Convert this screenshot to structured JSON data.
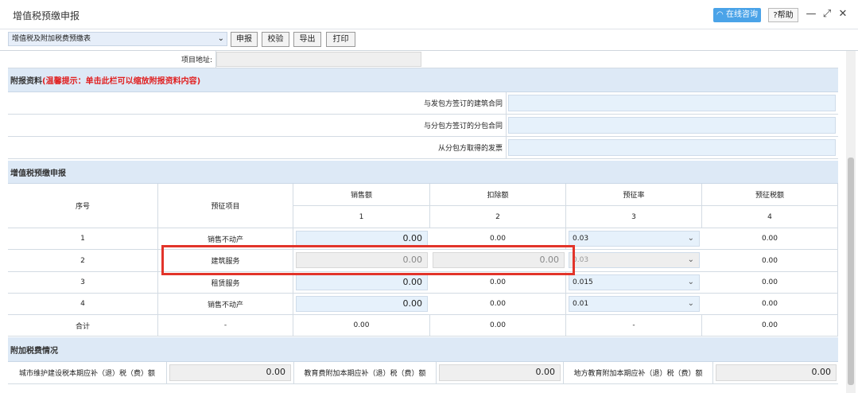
{
  "window": {
    "title": "增值税预缴申报",
    "consult_label": "在线咨询",
    "help_label": "?帮助"
  },
  "toolbar": {
    "report_select": "增值税及附加税费预缴表",
    "declare": "申报",
    "verify": "校验",
    "export": "导出",
    "print": "打印"
  },
  "project_address_label": "项目地址:",
  "attachments": {
    "title": "附报资料",
    "hint": "(温馨提示：单击此栏可以缩放附报资料内容)",
    "items": [
      "与发包方签订的建筑合同",
      "与分包方签订的分包合同",
      "从分包方取得的发票"
    ]
  },
  "vat": {
    "title": "增值税预缴申报",
    "headers": {
      "seq": "序号",
      "item": "预征项目",
      "sales": "销售额",
      "deduct": "扣除额",
      "rate": "预征率",
      "tax": "预征税额"
    },
    "col_nums": [
      "1",
      "2",
      "3",
      "4"
    ],
    "rows": [
      {
        "seq": "1",
        "item": "销售不动产",
        "sales": "0.00",
        "deduct": "0.00",
        "rate": "0.03",
        "tax": "0.00"
      },
      {
        "seq": "2",
        "item": "建筑服务",
        "sales": "0.00",
        "deduct": "0.00",
        "rate": "0.03",
        "tax": "0.00"
      },
      {
        "seq": "3",
        "item": "租赁服务",
        "sales": "0.00",
        "deduct": "0.00",
        "rate": "0.015",
        "tax": "0.00"
      },
      {
        "seq": "4",
        "item": "销售不动产",
        "sales": "0.00",
        "deduct": "0.00",
        "rate": "0.01",
        "tax": "0.00"
      }
    ],
    "total": {
      "label": "合计",
      "item": "-",
      "sales": "0.00",
      "deduct": "0.00",
      "rate": "-",
      "tax": "0.00"
    }
  },
  "surtax": {
    "title": "附加税费情况",
    "items": [
      {
        "label": "城市维护建设税本期应补（退）税（费）额",
        "value": "0.00"
      },
      {
        "label": "教育费附加本期应补（退）税（费）额",
        "value": "0.00"
      },
      {
        "label": "地方教育附加本期应补（退）税（费）额",
        "value": "0.00"
      }
    ]
  }
}
